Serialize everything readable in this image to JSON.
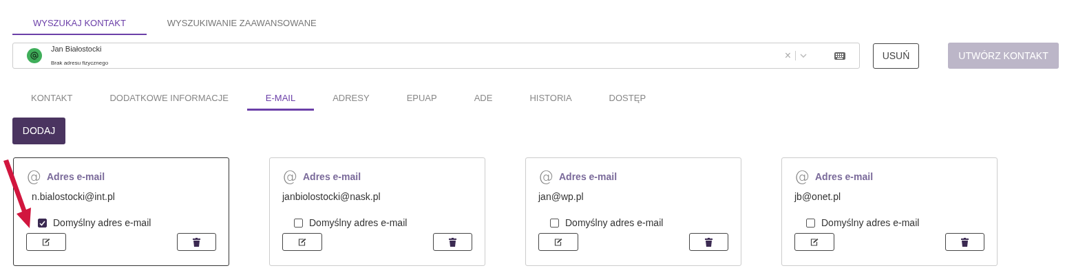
{
  "top_tabs": [
    {
      "label": "WYSZUKAJ KONTAKT",
      "selected": true
    },
    {
      "label": "WYSZUKIWANIE ZAAWANSOWANE",
      "selected": false
    }
  ],
  "search": {
    "name": "Jan Białostocki",
    "subtitle": "Brak adresu fizycznego",
    "clear": "×"
  },
  "buttons": [
    {
      "label": "USUŃ",
      "disabled": false
    },
    {
      "label": "UTWÓRZ KONTAKT",
      "disabled": true
    }
  ],
  "tabs": [
    {
      "label": "KONTAKT",
      "selected": false
    },
    {
      "label": "DODATKOWE INFORMACJE",
      "selected": false
    },
    {
      "label": "E-MAIL",
      "selected": true
    },
    {
      "label": "ADRESY",
      "selected": false
    },
    {
      "label": "EPUAP",
      "selected": false
    },
    {
      "label": "ADE",
      "selected": false
    },
    {
      "label": "HISTORIA",
      "selected": false
    },
    {
      "label": "DOSTĘP",
      "selected": false
    }
  ],
  "add_button": "DODAJ",
  "emails": [
    {
      "icon": "@",
      "title": "Adres e-mail",
      "address": "n.bialostocki@int.pl",
      "default_label": "Domyślny adres e-mail",
      "checked": true
    },
    {
      "icon": "@",
      "title": "Adres e-mail",
      "address": "janbiolostocki@nask.pl",
      "default_label": "Domyślny adres e-mail",
      "checked": false
    },
    {
      "icon": "@",
      "title": "Adres e-mail",
      "address": "jan@wp.pl",
      "default_label": "Domyślny adres e-mail",
      "checked": false
    },
    {
      "icon": "@",
      "title": "Adres e-mail",
      "address": "jb@onet.pl",
      "default_label": "Domyślny adres e-mail",
      "checked": false
    }
  ]
}
